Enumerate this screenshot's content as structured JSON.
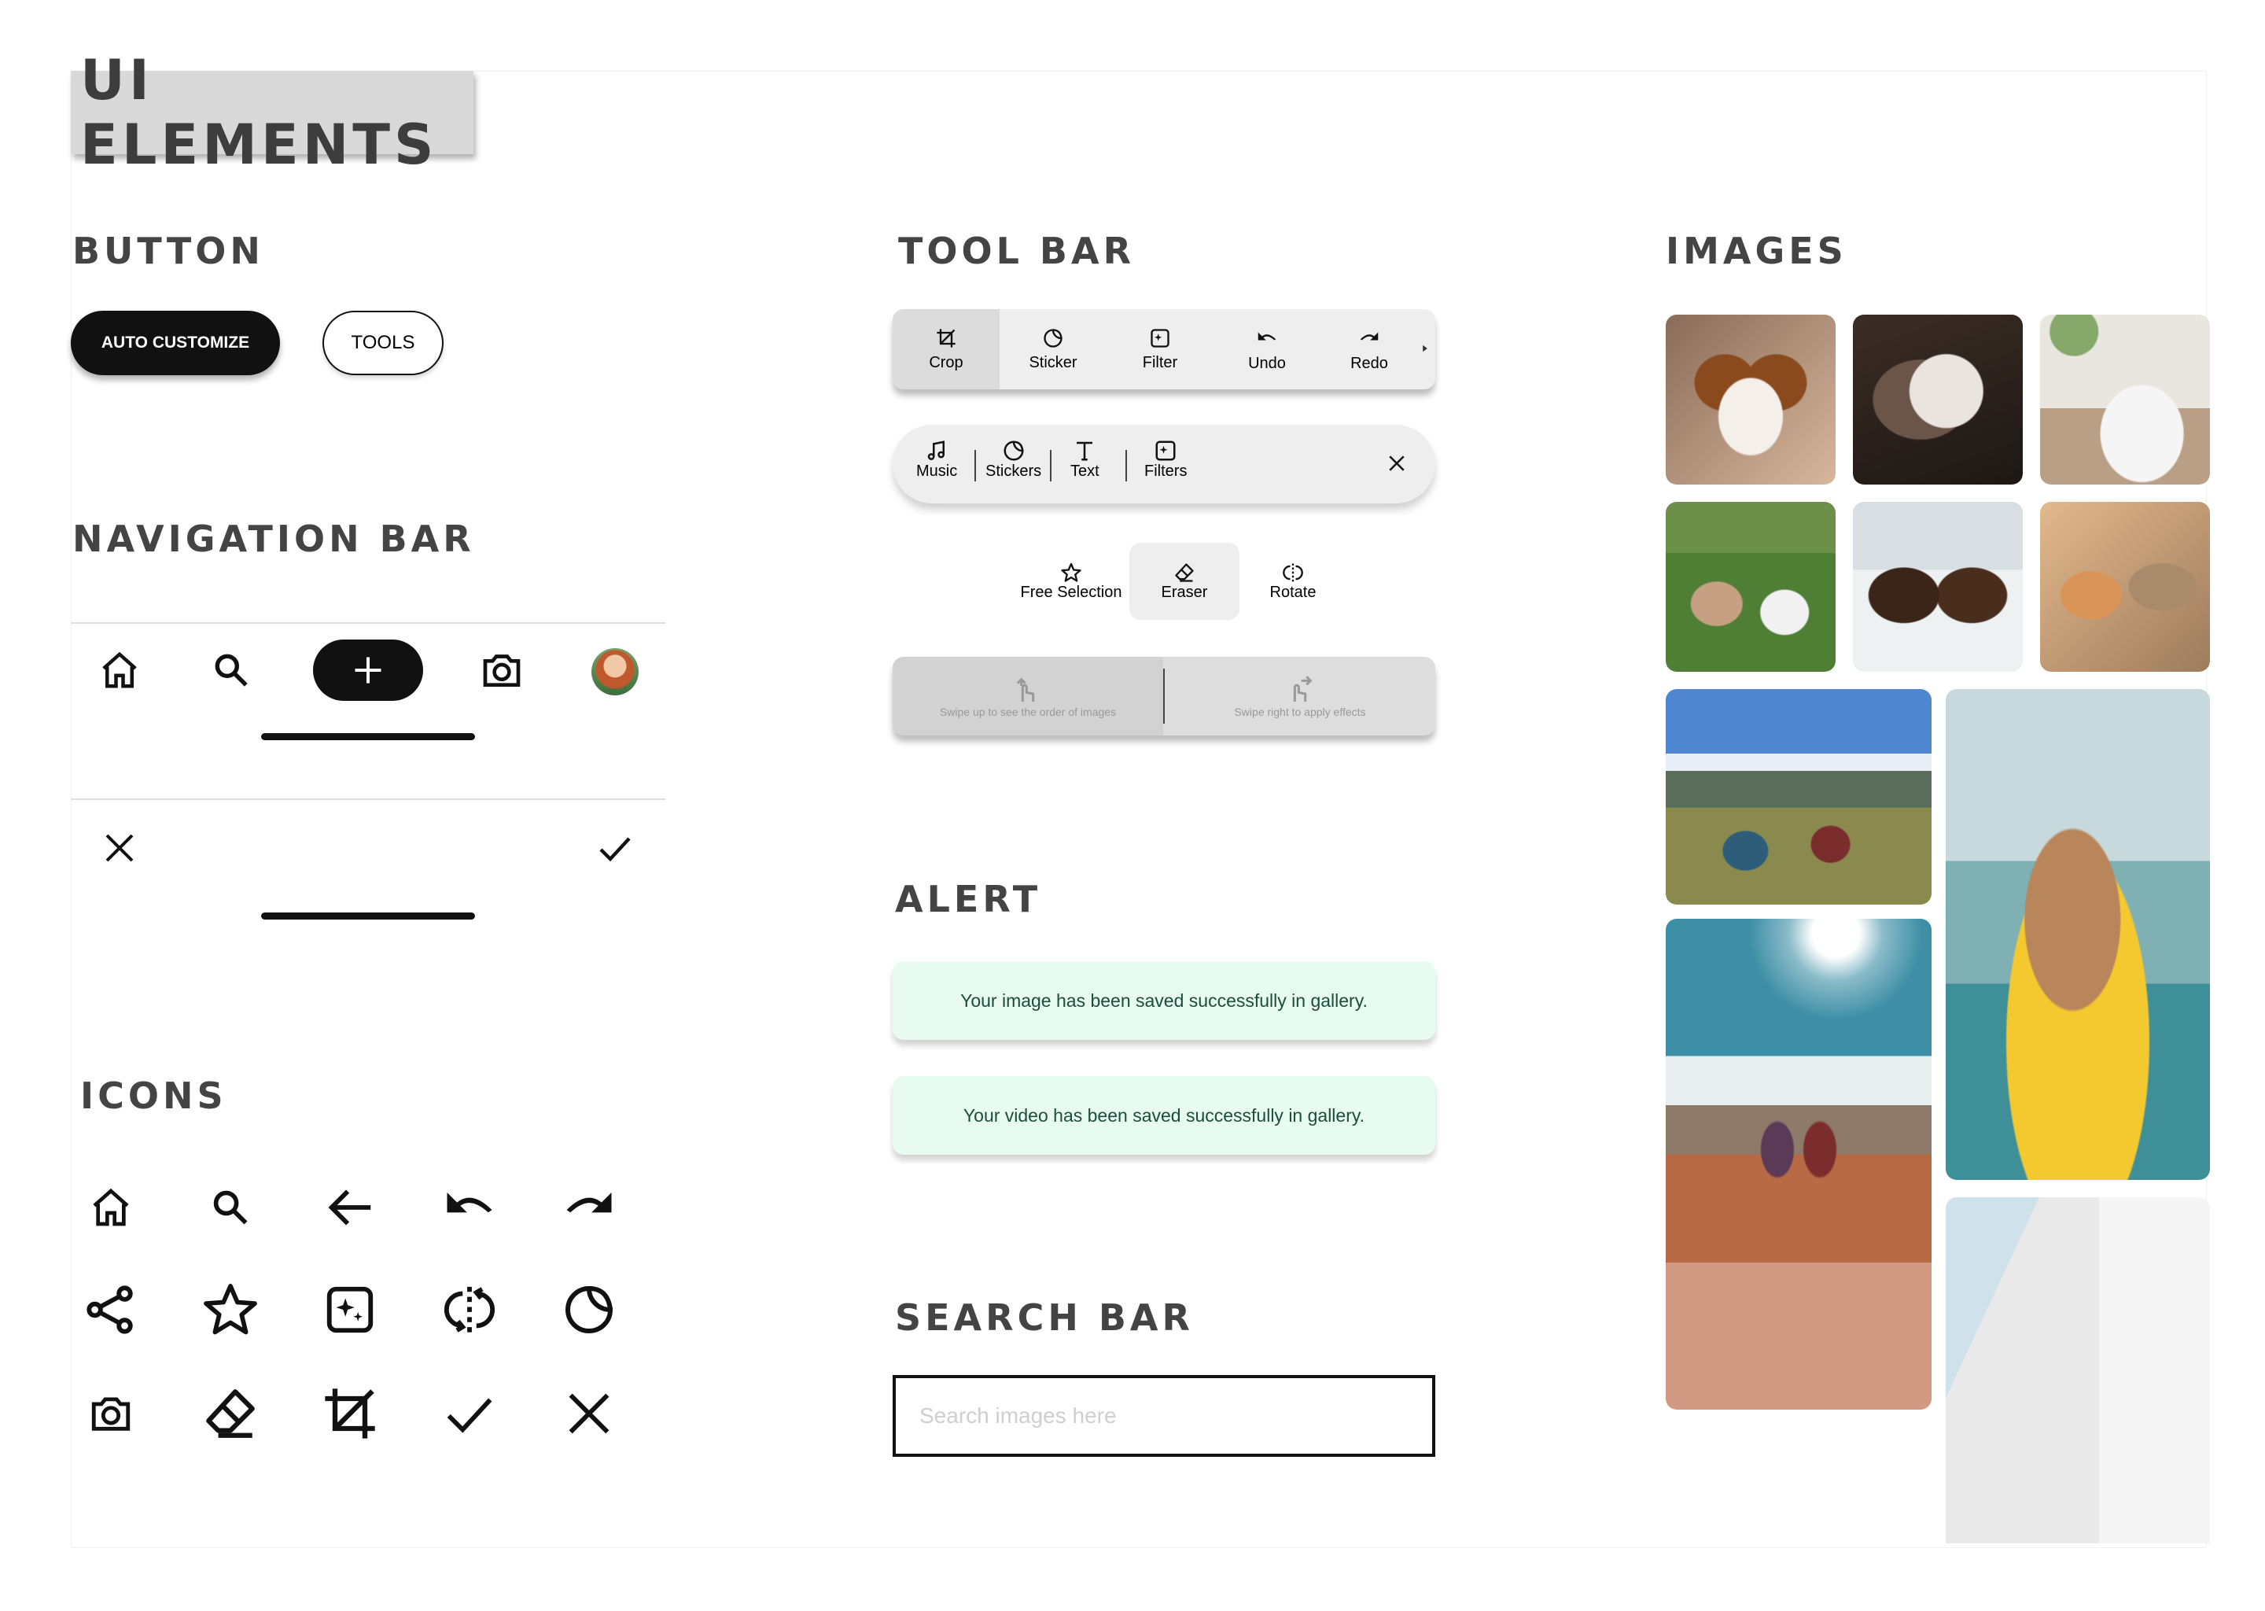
{
  "page_title": "UI ELEMENTS",
  "sections": {
    "button": "BUTTON",
    "navigation_bar": "NAVIGATION BAR",
    "icons": "ICONS",
    "tool_bar": "TOOL BAR",
    "alert": "ALERT",
    "search_bar": "SEARCH BAR",
    "images": "IMAGES"
  },
  "buttons": {
    "primary_label": "AUTO CUSTOMIZE",
    "secondary_label": "TOOLS"
  },
  "navbar_main": {
    "items": [
      {
        "icon": "home-icon"
      },
      {
        "icon": "search-icon"
      },
      {
        "icon": "plus-icon"
      },
      {
        "icon": "camera-icon"
      },
      {
        "icon": "avatar"
      }
    ]
  },
  "navbar_confirm": {
    "items": [
      {
        "icon": "close-icon"
      },
      {
        "icon": "check-icon"
      }
    ]
  },
  "toolbar_edit": {
    "items": [
      {
        "label": "Crop",
        "icon": "crop-icon",
        "active": true
      },
      {
        "label": "Sticker",
        "icon": "sticker-icon"
      },
      {
        "label": "Filter",
        "icon": "filter-icon"
      },
      {
        "label": "Undo",
        "icon": "undo-icon"
      },
      {
        "label": "Redo",
        "icon": "redo-icon"
      }
    ]
  },
  "toolbar_media": {
    "items": [
      {
        "label": "Music",
        "icon": "music-icon"
      },
      {
        "label": "Stickers",
        "icon": "sticker-icon"
      },
      {
        "label": "Text",
        "icon": "text-icon"
      },
      {
        "label": "Filters",
        "icon": "filter-icon"
      }
    ],
    "close_icon": "close-icon"
  },
  "toolbar_selection": {
    "items": [
      {
        "label": "Free Selection",
        "icon": "star-icon"
      },
      {
        "label": "Eraser",
        "icon": "eraser-icon",
        "active": true
      },
      {
        "label": "Rotate",
        "icon": "rotate-icon"
      }
    ]
  },
  "toolbar_hints": {
    "items": [
      {
        "label": "Swipe up to see the order of images",
        "icon": "swipe-up-icon",
        "active": true
      },
      {
        "label": "Swipe right to apply effects",
        "icon": "swipe-right-icon"
      }
    ]
  },
  "alerts": [
    "Your image has been saved successfully in gallery.",
    "Your video has been saved successfully in gallery."
  ],
  "search": {
    "placeholder": "Search images here",
    "value": ""
  },
  "icon_set": [
    "home-icon",
    "search-icon",
    "arrow-left-icon",
    "undo-icon",
    "redo-icon",
    "share-icon",
    "star-icon",
    "filter-icon",
    "rotate-icon",
    "sticker-icon",
    "camera-icon",
    "eraser-icon",
    "crop-icon",
    "check-icon",
    "close-icon"
  ],
  "images": [
    {
      "name": "dog-portrait-image"
    },
    {
      "name": "husky-puppy-image"
    },
    {
      "name": "dalmatian-image"
    },
    {
      "name": "dogs-on-grass-image"
    },
    {
      "name": "poodles-image"
    },
    {
      "name": "corgi-terrier-image"
    },
    {
      "name": "hikers-valley-image"
    },
    {
      "name": "bulldog-kayak-image"
    },
    {
      "name": "hikers-mountain-image"
    },
    {
      "name": "building-image"
    }
  ],
  "colors": {
    "primary": "#111111",
    "toolbar_bg": "#eeeeee",
    "toolbar_active": "#dcdcdc",
    "alert_bg": "#e8fbf1",
    "alert_text": "#1a4d3b",
    "heading": "#444444"
  }
}
